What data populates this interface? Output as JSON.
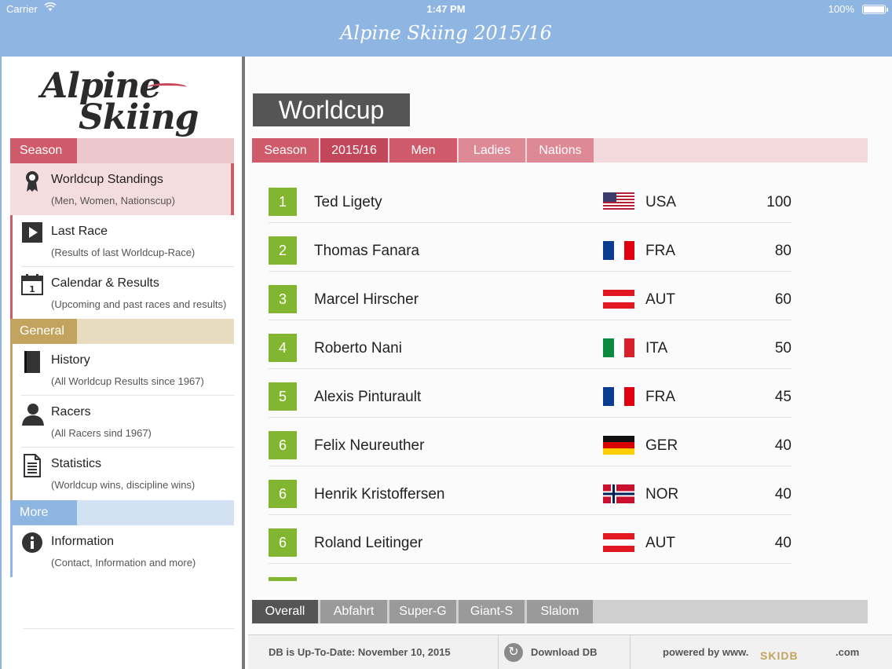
{
  "status": {
    "carrier": "Carrier",
    "time": "1:47 PM",
    "battery": "100%"
  },
  "nav": {
    "title": "Alpine Skiing 2015/16"
  },
  "logo": {
    "line1": "Alpine",
    "line2": "Skiing"
  },
  "sidebar": {
    "sections": [
      {
        "label": "Season",
        "color": "#cf5a6a"
      },
      {
        "label": "General",
        "color": "#c2a45e"
      },
      {
        "label": "More",
        "color": "#8fb5e3"
      }
    ],
    "items": [
      {
        "title": "Worldcup Standings",
        "subtitle": "(Men, Women, Nationscup)",
        "icon": "medal-icon"
      },
      {
        "title": "Last Race",
        "subtitle": "(Results of last Worldcup-Race)",
        "icon": "play-icon"
      },
      {
        "title": "Calendar & Results",
        "subtitle": "(Upcoming and past races and results)",
        "icon": "calendar-icon"
      },
      {
        "title": "History",
        "subtitle": "(All Worldcup Results since 1967)",
        "icon": "book-icon"
      },
      {
        "title": "Racers",
        "subtitle": "(All Racers sind 1967)",
        "icon": "person-icon"
      },
      {
        "title": "Statistics",
        "subtitle": "(Worldcup wins, discipline wins)",
        "icon": "document-icon"
      },
      {
        "title": "Information",
        "subtitle": "(Contact, Information and more)",
        "icon": "info-icon"
      }
    ]
  },
  "main": {
    "title": "Worldcup",
    "tabs": [
      {
        "label": "Season"
      },
      {
        "label": "2015/16"
      },
      {
        "label": "Men",
        "selected": true
      },
      {
        "label": "Ladies"
      },
      {
        "label": "Nations"
      }
    ],
    "standings": [
      {
        "rank": "1",
        "name": "Ted  Ligety",
        "country": "USA",
        "points": "100",
        "flag": "usa"
      },
      {
        "rank": "2",
        "name": "Thomas  Fanara",
        "country": "FRA",
        "points": "80",
        "flag": "fra"
      },
      {
        "rank": "3",
        "name": "Marcel  Hirscher",
        "country": "AUT",
        "points": "60",
        "flag": "aut"
      },
      {
        "rank": "4",
        "name": "Roberto  Nani",
        "country": "ITA",
        "points": "50",
        "flag": "ita"
      },
      {
        "rank": "5",
        "name": "Alexis  Pinturault",
        "country": "FRA",
        "points": "45",
        "flag": "fra"
      },
      {
        "rank": "6",
        "name": "Felix  Neureuther",
        "country": "GER",
        "points": "40",
        "flag": "ger"
      },
      {
        "rank": "6",
        "name": "Henrik  Kristoffersen",
        "country": "NOR",
        "points": "40",
        "flag": "nor"
      },
      {
        "rank": "6",
        "name": "Roland  Leitinger",
        "country": "AUT",
        "points": "40",
        "flag": "aut"
      },
      {
        "rank": "",
        "name": "",
        "country": "",
        "points": "",
        "flag": ""
      }
    ],
    "disciplines": [
      {
        "label": "Overall",
        "selected": true
      },
      {
        "label": "Abfahrt"
      },
      {
        "label": "Super-G"
      },
      {
        "label": "Giant-S"
      },
      {
        "label": "Slalom"
      }
    ]
  },
  "footer": {
    "db_status": "DB is Up-To-Date: November 10, 2015",
    "download": "Download DB",
    "powered": "powered by www.",
    "brand": "SKIDB",
    "domain": ".com"
  },
  "colors": {
    "navbar": "#8fb5e3",
    "season": "#cf5a6a",
    "general": "#c2a45e",
    "more": "#8fb5e3",
    "rank_badge": "#82b630"
  }
}
